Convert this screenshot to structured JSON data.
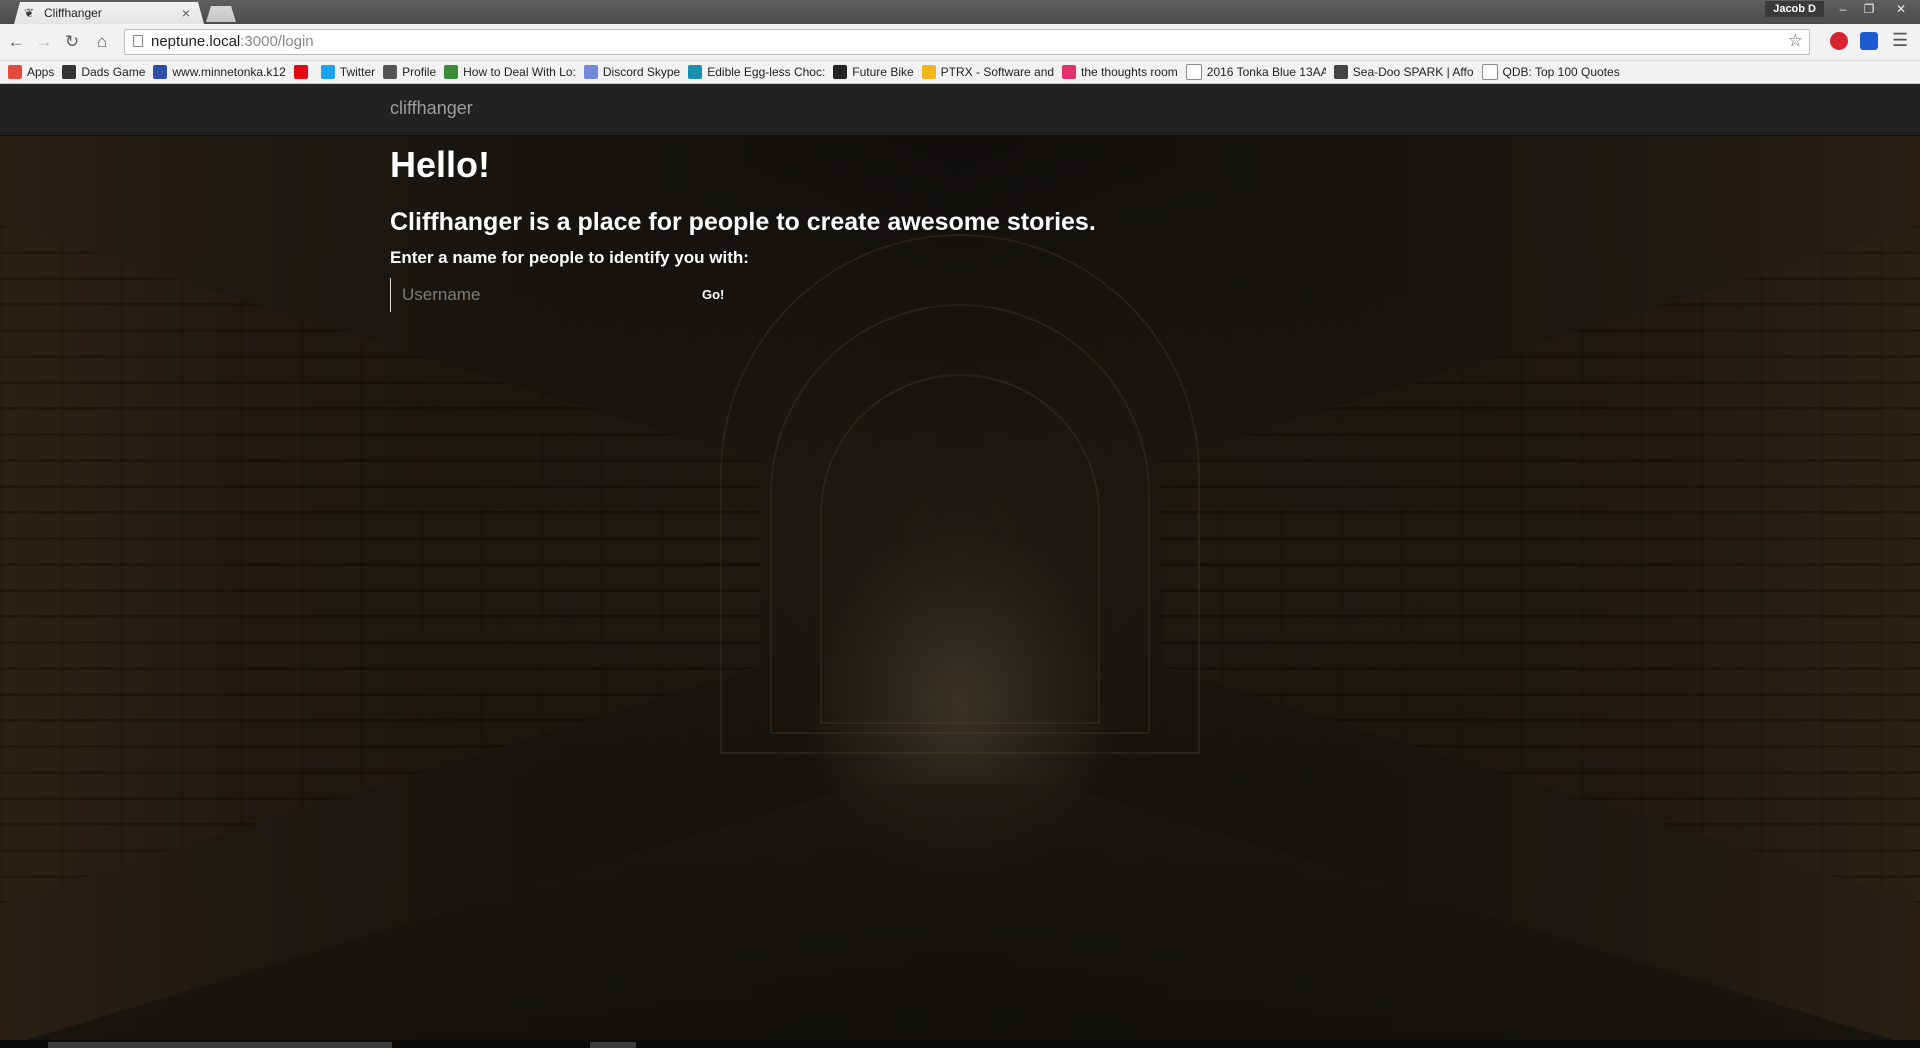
{
  "browser": {
    "tab_title": "Cliffhanger",
    "tab_icon": "feather-icon",
    "user_name": "Jacob D",
    "url_host": "neptune.local",
    "url_path": ":3000/login",
    "bookmarks": [
      {
        "label": "Apps",
        "icon": "apps-grid-icon",
        "color": "#e24b3b"
      },
      {
        "label": "Dads Game",
        "icon": "bookmark-icon",
        "color": "#333333"
      },
      {
        "label": "www.minnetonka.k12",
        "icon": "bookmark-icon",
        "color": "#2c4fa8"
      },
      {
        "label": "",
        "icon": "netflix-icon",
        "color": "#e50914"
      },
      {
        "label": "Twitter",
        "icon": "twitter-icon",
        "color": "#1da1f2"
      },
      {
        "label": "Profile",
        "icon": "bookmark-icon",
        "color": "#555555"
      },
      {
        "label": "How to Deal With Lo:",
        "icon": "bookmark-icon",
        "color": "#3d8b37"
      },
      {
        "label": "Discord Skype",
        "icon": "discord-icon",
        "color": "#7289da"
      },
      {
        "label": "Edible Egg-less Choc:",
        "icon": "bookmark-icon",
        "color": "#1a8fb0"
      },
      {
        "label": "Future Bike",
        "icon": "bookmark-icon",
        "color": "#222222"
      },
      {
        "label": "PTRX - Software and",
        "icon": "bookmark-icon",
        "color": "#f2b619"
      },
      {
        "label": "the thoughts room",
        "icon": "bookmark-icon",
        "color": "#e1306c"
      },
      {
        "label": "2016 Tonka Blue 13AA",
        "icon": "page-icon",
        "color": "#ffffff"
      },
      {
        "label": "Sea-Doo SPARK | Affo",
        "icon": "bookmark-icon",
        "color": "#444444"
      },
      {
        "label": "QDB: Top 100 Quotes",
        "icon": "page-icon",
        "color": "#ffffff"
      }
    ]
  },
  "app": {
    "brand": "cliffhanger",
    "heading": "Hello!",
    "tagline": "Cliffhanger is a place for people to create awesome stories.",
    "prompt": "Enter a name for people to identify you with:",
    "username_placeholder": "Username",
    "go_label": "Go!"
  }
}
